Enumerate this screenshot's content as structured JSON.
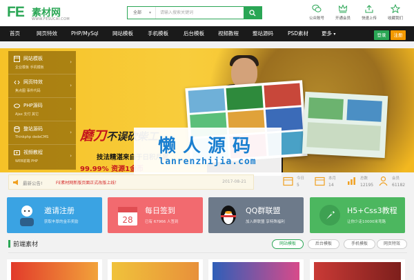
{
  "header": {
    "logo_mark": "FE",
    "logo_cn": "素材网",
    "logo_url": "WWW.FESUCAI.COM",
    "search": {
      "scope": "全部",
      "placeholder": "请输入搜索关键词"
    },
    "tools": [
      {
        "label": "公众账号",
        "icon": "wechat-icon"
      },
      {
        "label": "开通会员",
        "icon": "crown-icon"
      },
      {
        "label": "快速上传",
        "icon": "upload-icon"
      },
      {
        "label": "收藏我们",
        "icon": "star-icon"
      }
    ]
  },
  "nav": {
    "items": [
      "首页",
      "网页特效",
      "PHP/MySql",
      "网站模板",
      "手机模板",
      "后台模板",
      "视频教程",
      "整站源码",
      "PSD素材",
      "更多"
    ],
    "login": "登录",
    "register": "注册"
  },
  "banner": {
    "slogan_big": "磨刀",
    "slogan_rest": "不误砍柴工",
    "slogan_line2": "技法精湛来自于日积月累",
    "slogan_line3": "99.99% 资源1金币",
    "side_menu": [
      {
        "title": "网站模板",
        "subs": "企业模板  手机模板"
      },
      {
        "title": "网页特效",
        "subs": "焦点图  事件代码"
      },
      {
        "title": "PHP源码",
        "subs": "Ajax  支付  其它"
      },
      {
        "title": "整站源码",
        "subs": "Thinkphp  dedeCMS"
      },
      {
        "title": "视频教程",
        "subs": "WEB前端  PHP"
      }
    ]
  },
  "watermark": {
    "cn": "懒人源码",
    "url": "lanrenzhijia.com"
  },
  "notice": {
    "label": "最新公告!",
    "text": "FE素材网新版页面正式改版上线！",
    "date": "2017-08-21"
  },
  "stats": [
    {
      "label": "今日",
      "value": "5",
      "icon": "calendar-icon"
    },
    {
      "label": "本月",
      "value": "14",
      "icon": "calendar-icon"
    },
    {
      "label": "总数",
      "value": "12195",
      "icon": "chart-icon"
    },
    {
      "label": "会员",
      "value": "61182",
      "icon": "user-icon"
    }
  ],
  "tiles": [
    {
      "title": "邀请注册",
      "sub": "获取丰厚的金币奖励",
      "color": "#3aa3e3"
    },
    {
      "title": "每日签到",
      "sub": "已有 67966 人签到",
      "color": "#f26a6f"
    },
    {
      "title": "QQ群联盟",
      "sub": "加入群联盟 享特殊福利",
      "color": "#6d7a8a"
    },
    {
      "title": "H5+Css3教程",
      "sub": "让你少走10000米弯路",
      "color": "#4cb75f"
    }
  ],
  "section": {
    "title": "前端素材",
    "tabs": [
      "网站模板",
      "后台模板",
      "手机模板",
      "网页特效"
    ]
  }
}
